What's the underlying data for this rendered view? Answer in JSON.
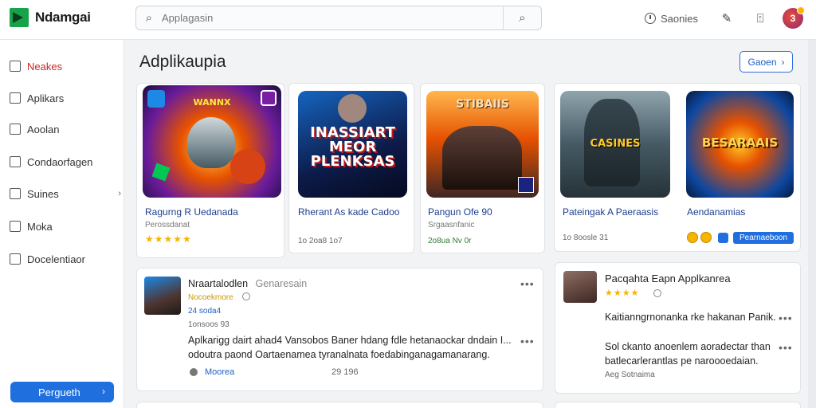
{
  "app": {
    "logo_text": "Ndamgai"
  },
  "search": {
    "placeholder": "Applagasin"
  },
  "header": {
    "sources_label": "Saonies"
  },
  "user": {
    "avatar_initial": "3"
  },
  "sidebar": {
    "items": [
      {
        "label": "Neakes"
      },
      {
        "label": "Aplikars"
      },
      {
        "label": "Aoolan"
      },
      {
        "label": "Condaorfagen"
      },
      {
        "label": "Suines"
      },
      {
        "label": "Moka"
      },
      {
        "label": "Docelentiaor"
      }
    ],
    "cta_label": "Pergueth"
  },
  "main": {
    "title": "Adplikaupia",
    "see_all_label": "Gaoen"
  },
  "apps": [
    {
      "thumb_label": "WANNX",
      "name": "Ragurng R Uedanada",
      "sub": "Perossdanat",
      "rating_stars": "★★★★★"
    },
    {
      "thumb_label": "INASSIART MEOR PLENKSAS",
      "name": "Rherant As kade Cadoo",
      "meta": "1o 2oa8 1o7"
    },
    {
      "thumb_label": "STIBAIIS",
      "name": "Pangun  Ofe 90",
      "sub": "Srgaasnfanic",
      "meta": "2o8ua Nv 0r"
    },
    {
      "thumb_label": "CASINES",
      "name": "Pateingak A Paeraasis",
      "meta": "1o 8oosle 31"
    },
    {
      "thumb_label": "BESARAAIS",
      "name": "Aendanamias",
      "action_label": "Pearnaeboon"
    }
  ],
  "feed_left": {
    "title": "Nraartalodlen",
    "title_suffix": "Genaresain",
    "tag": "Nocoekmore",
    "tag2": "24 soda4",
    "date": "1onsoos 93",
    "body_line1": "Aplkarigg dairt ahad4 Vansobos Baner hdang fdle hetanaockar dndain I...",
    "body_line2": "odoutra paond Oartaenamea tyranalnata foedabinganagamanarang.",
    "footer_link": "Moorea",
    "footer_count": "29 196"
  },
  "feed_right": {
    "title": "Pacqahta Eapn Applkanrea",
    "rating_stars": "★★★★",
    "line1": "Kaitianngrnonanka rke hakanan Panik.",
    "line2": "Sol ckanto anoenlem aoradectar than",
    "line3": "batlecarlerantlas pe naroooedaian.",
    "footer": "Aeg Sotnaima"
  },
  "colors": {
    "accent": "#1f6fde",
    "active_nav": "#c62828",
    "star": "#f4b400"
  }
}
